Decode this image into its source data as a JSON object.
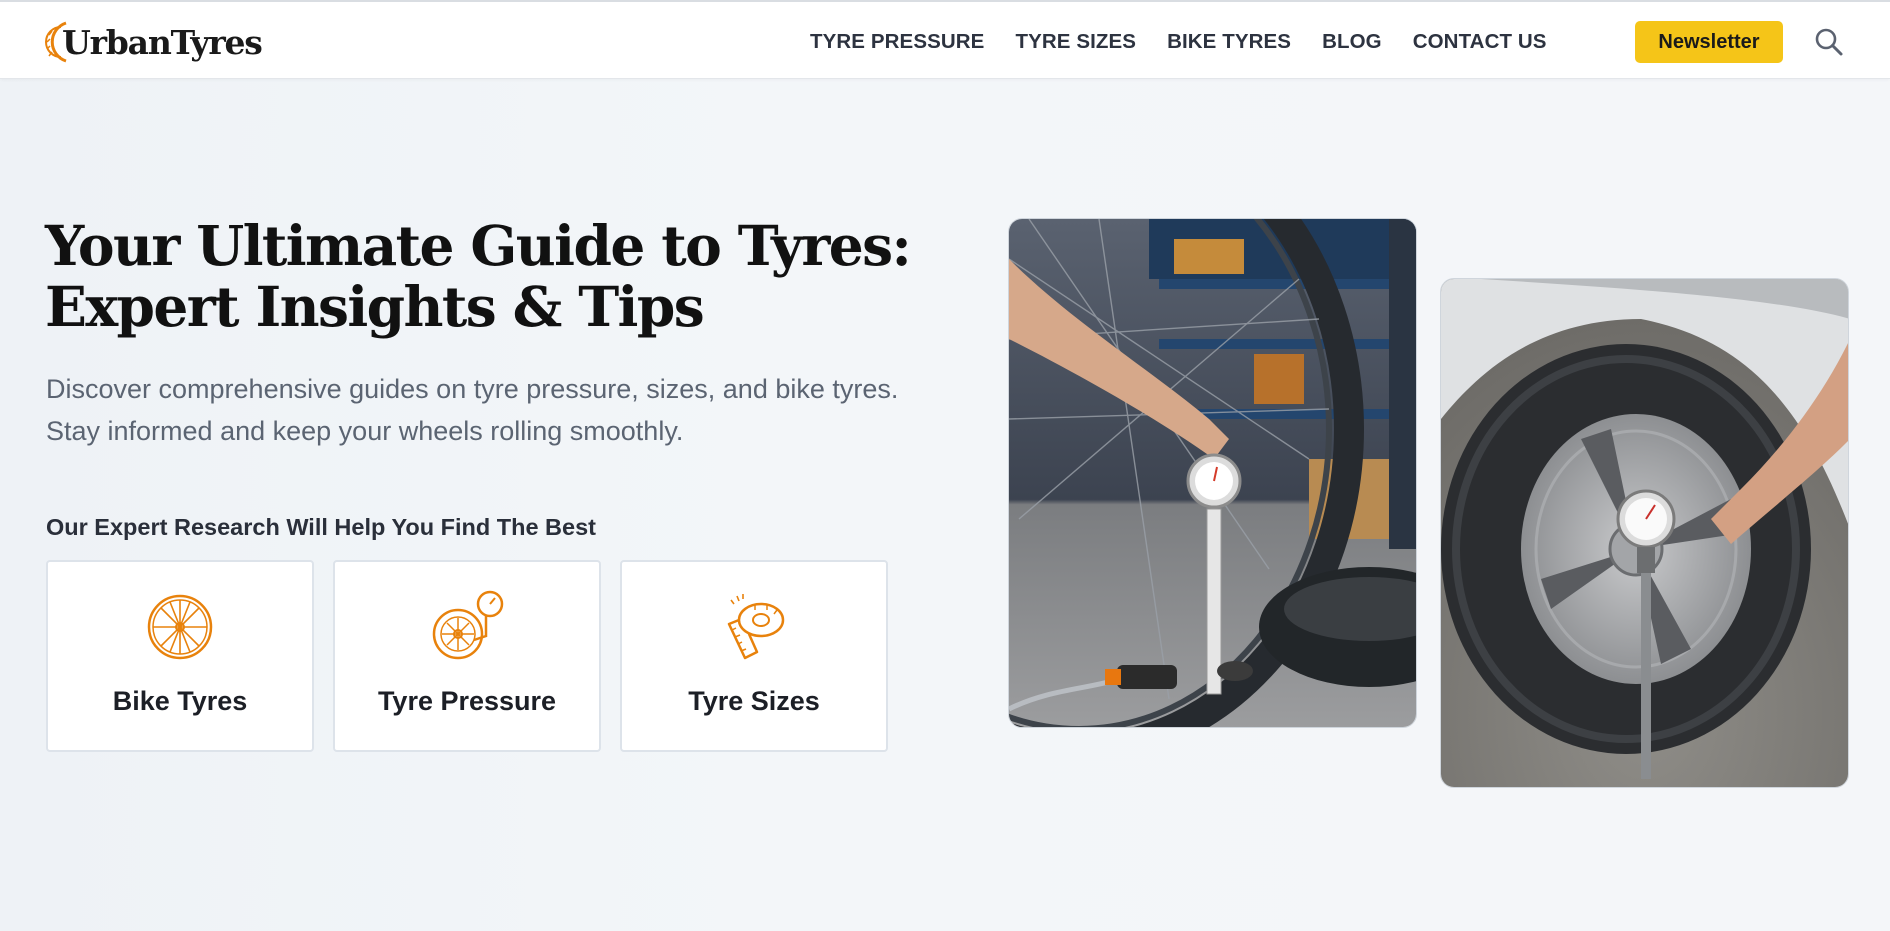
{
  "brand": {
    "name": "UrbanTyres",
    "accent": "#f5c518",
    "icon_accent": "#e8820c"
  },
  "nav": {
    "items": [
      {
        "label": "TYRE PRESSURE"
      },
      {
        "label": "TYRE SIZES"
      },
      {
        "label": "BIKE TYRES"
      },
      {
        "label": "BLOG"
      },
      {
        "label": "CONTACT US"
      }
    ],
    "newsletter_label": "Newsletter",
    "search_icon": "search-icon"
  },
  "hero": {
    "title_line1": "Your Ultimate Guide to Tyres:",
    "title_line2": "Expert Insights & Tips",
    "subtitle": "Discover comprehensive guides on tyre pressure, sizes, and bike tyres. Stay informed and keep your wheels rolling smoothly.",
    "research_label": "Our Expert Research Will Help You Find The Best"
  },
  "categories": [
    {
      "label": "Bike Tyres",
      "icon": "bike-wheel-icon"
    },
    {
      "label": "Tyre Pressure",
      "icon": "pressure-gauge-icon"
    },
    {
      "label": "Tyre Sizes",
      "icon": "measuring-tape-icon"
    }
  ],
  "photos": [
    {
      "subject": "bike-tyre-pressure-gauge-photo"
    },
    {
      "subject": "car-tyre-pressure-gauge-photo"
    }
  ]
}
